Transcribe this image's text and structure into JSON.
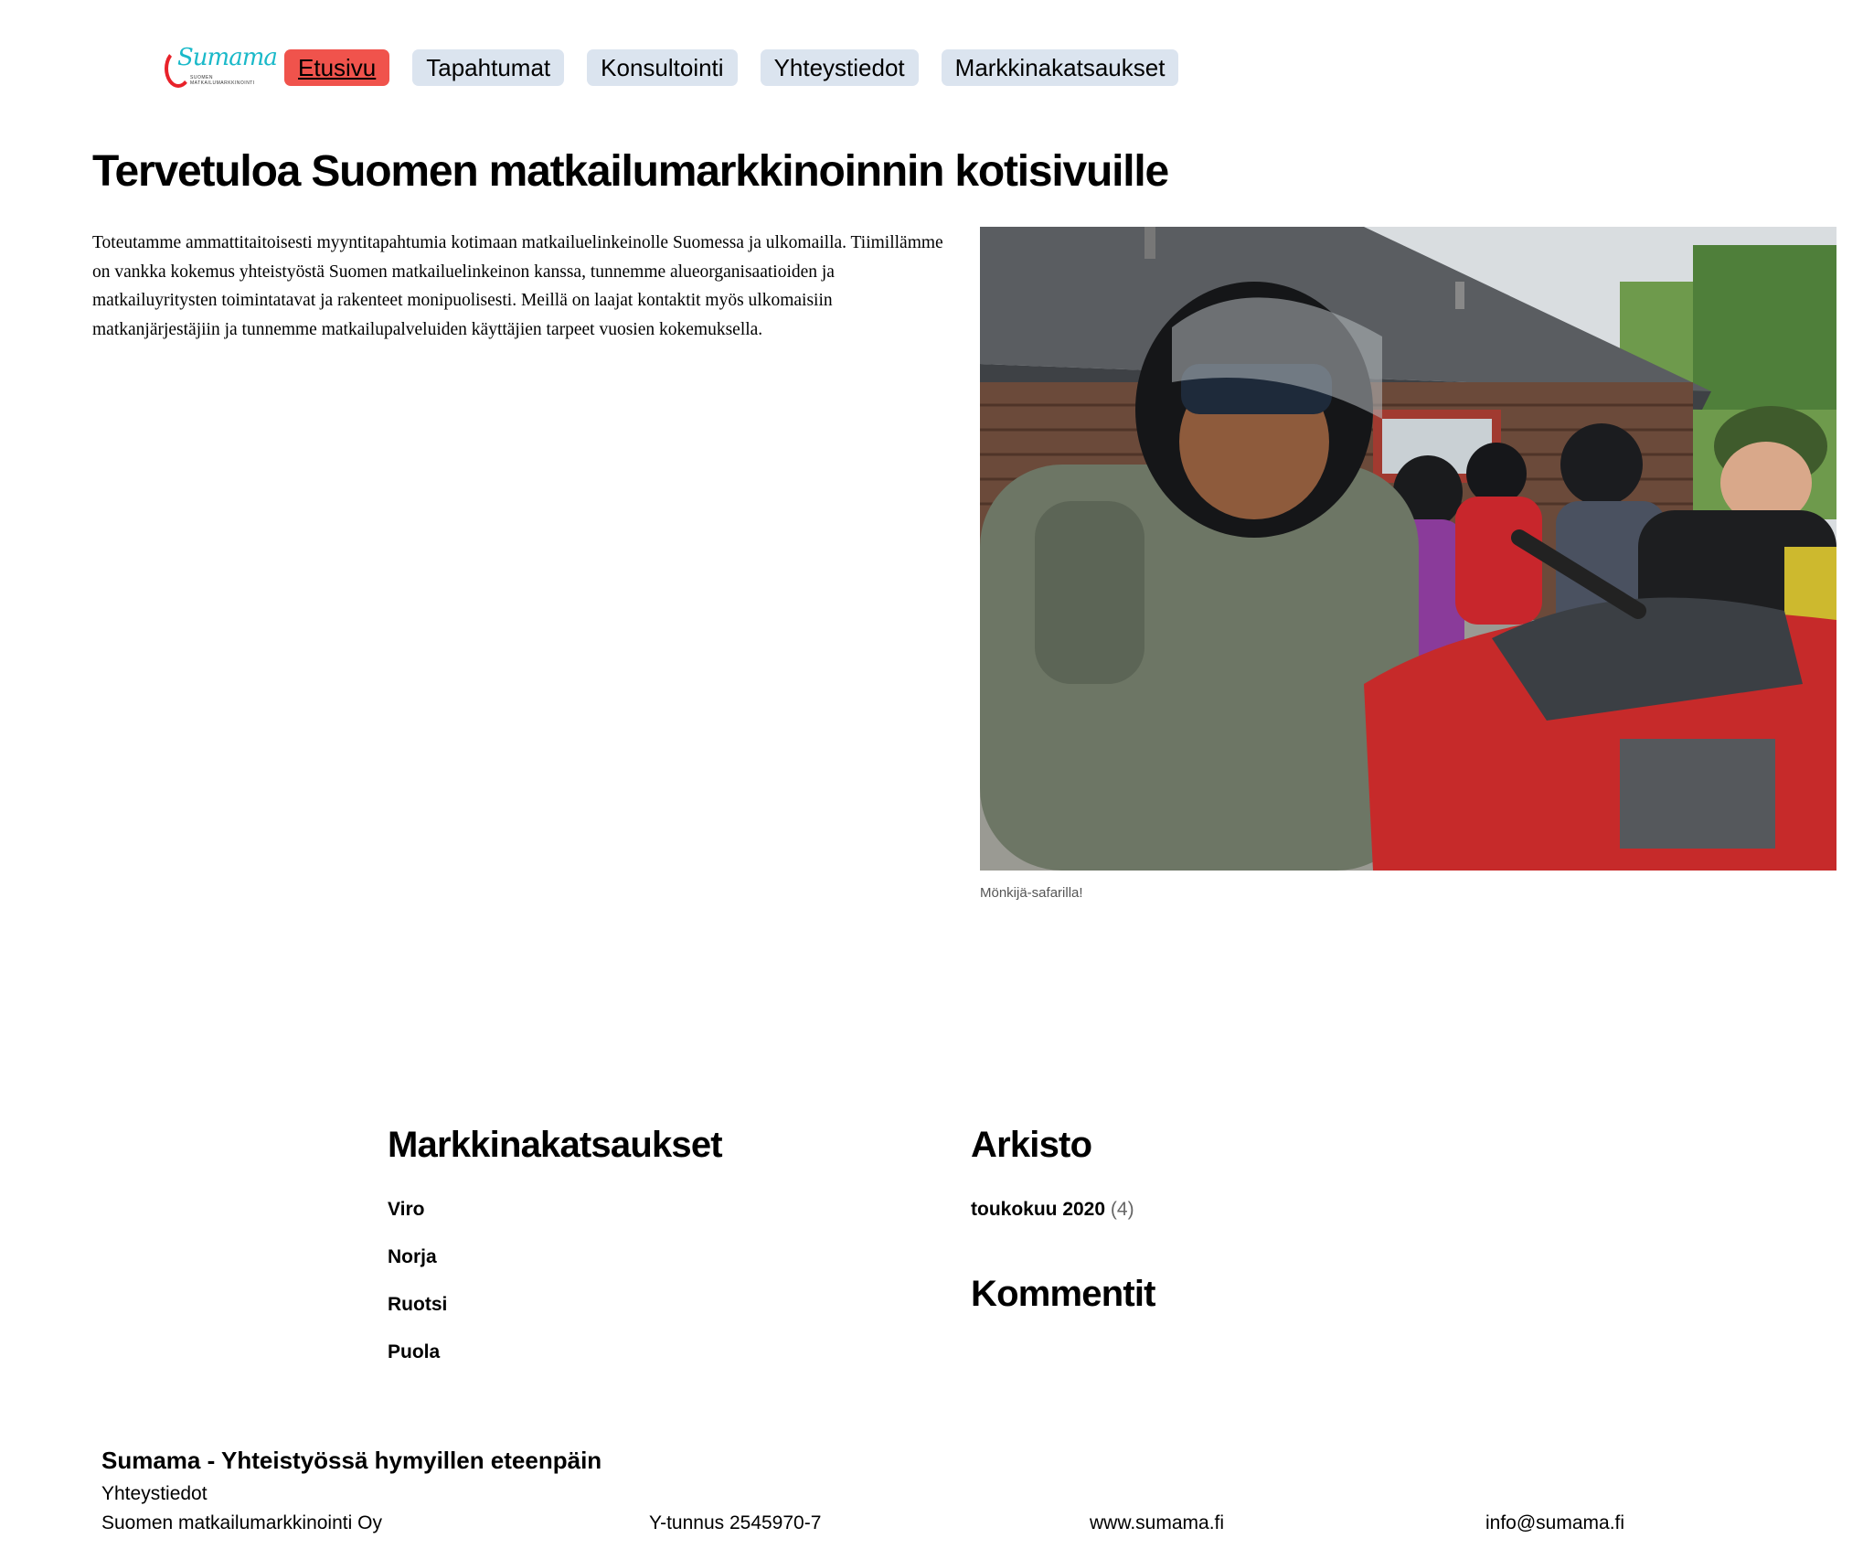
{
  "header": {
    "logo_text": "Sumama",
    "logo_tagline": "SUOMEN MATKAILUMARKKINOINTI",
    "nav": [
      {
        "label": "Etusivu",
        "active": true
      },
      {
        "label": "Tapahtumat",
        "active": false
      },
      {
        "label": "Konsultointi",
        "active": false
      },
      {
        "label": "Yhteystiedot",
        "active": false
      },
      {
        "label": "Markkinakatsaukset",
        "active": false
      }
    ]
  },
  "main": {
    "title": "Tervetuloa Suomen matkailumarkkinoinnin kotisivuille",
    "intro": "Toteutamme ammattitaitoisesti myyntitapahtumia kotimaan matkailuelinkeinolle Suomessa ja ulkomailla. Tiimillämme on vankka kokemus yhteistyöstä Suomen matkailuelinkeinon kanssa, tunnemme alueorganisaatioiden ja matkailuyritysten toimintatavat ja rakenteet monipuolisesti. Meillä on laajat kontaktit myös ulkomaisiin matkanjärjestäjiin ja tunnemme matkailupalveluiden käyttäjien tarpeet vuosien kokemuksella.",
    "photo_caption": "Mönkijä-safarilla!"
  },
  "widgets": {
    "markets": {
      "title": "Markkinakatsaukset",
      "items": [
        "Viro",
        "Norja",
        "Ruotsi",
        "Puola"
      ]
    },
    "archive": {
      "title": "Arkisto",
      "items": [
        {
          "label": "toukokuu 2020",
          "count": "(4)"
        }
      ]
    },
    "comments": {
      "title": "Kommentit"
    }
  },
  "footer": {
    "title": "Sumama - Yhteistyössä hymyillen eteenpäin",
    "contact_label": "Yhteystiedot",
    "company": "Suomen matkailumarkkinointi Oy",
    "business_id": "Y-tunnus 2545970-7",
    "website": "www.sumama.fi",
    "email": "info@sumama.fi"
  },
  "colors": {
    "nav_active_bg": "#f0534c",
    "nav_bg": "#dbe4ef",
    "logo_teal": "#1ab9c9",
    "logo_red": "#e8222a"
  }
}
